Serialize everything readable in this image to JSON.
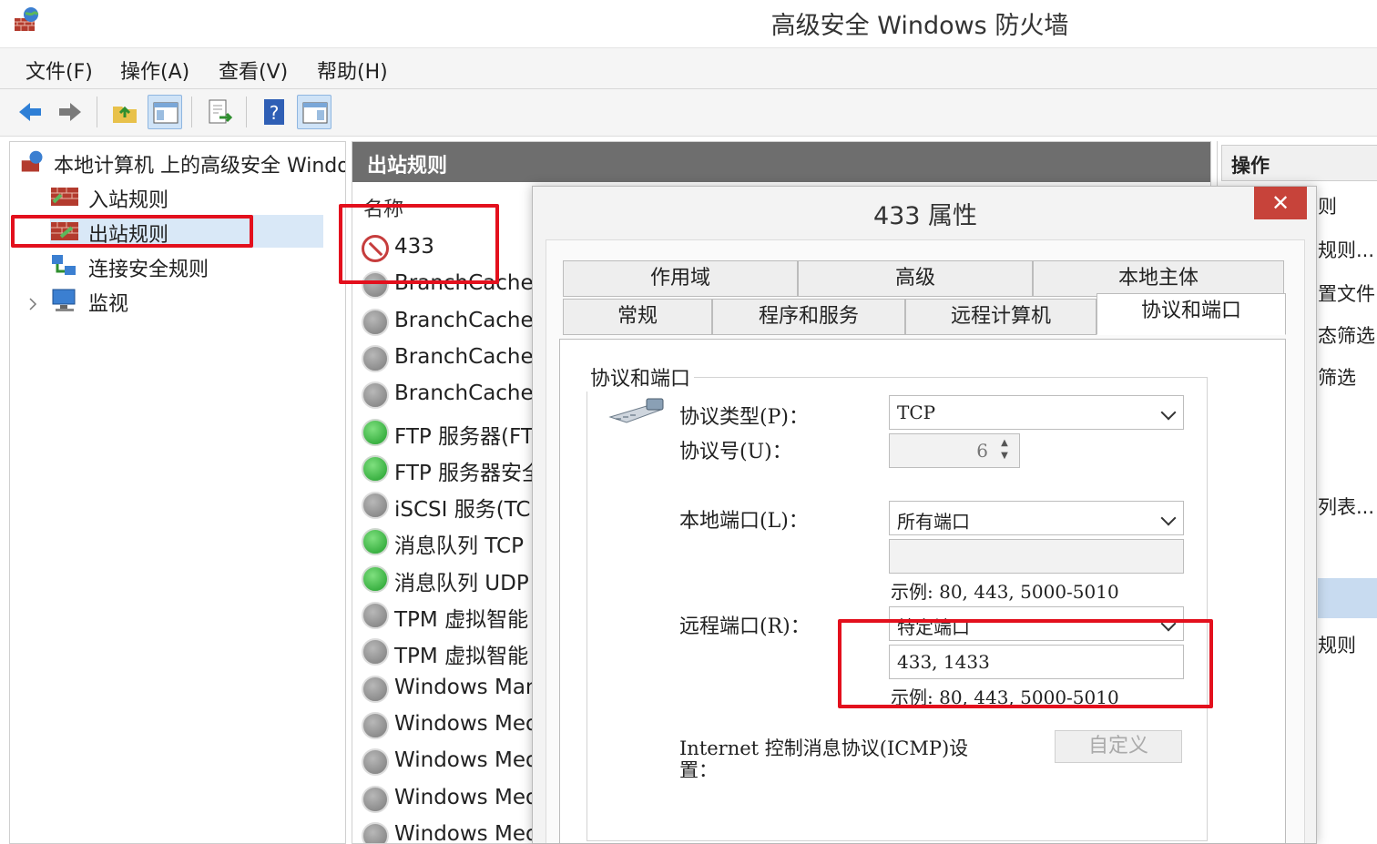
{
  "window": {
    "title": "高级安全 Windows 防火墙"
  },
  "menu": [
    "文件(F)",
    "操作(A)",
    "查看(V)",
    "帮助(H)"
  ],
  "tree": {
    "root": "本地计算机 上的高级安全 Windows",
    "items": [
      "入站规则",
      "出站规则",
      "连接安全规则",
      "监视"
    ]
  },
  "list": {
    "header": "出站规则",
    "column_name": "名称",
    "rules": [
      {
        "name": "433",
        "status": "blocked"
      },
      {
        "name": "BranchCache",
        "status": "disabled"
      },
      {
        "name": "BranchCache",
        "status": "disabled"
      },
      {
        "name": "BranchCache",
        "status": "disabled"
      },
      {
        "name": "BranchCache",
        "status": "disabled"
      },
      {
        "name": "FTP 服务器(FTP",
        "status": "enabled"
      },
      {
        "name": "FTP 服务器安全",
        "status": "enabled"
      },
      {
        "name": "iSCSI 服务(TCP",
        "status": "disabled"
      },
      {
        "name": "消息队列 TCP",
        "status": "enabled"
      },
      {
        "name": "消息队列 UDP",
        "status": "enabled"
      },
      {
        "name": "TPM 虚拟智能",
        "status": "disabled"
      },
      {
        "name": "TPM 虚拟智能",
        "status": "disabled"
      },
      {
        "name": "Windows Man",
        "status": "disabled"
      },
      {
        "name": "Windows Med",
        "status": "disabled"
      },
      {
        "name": "Windows Med",
        "status": "disabled"
      },
      {
        "name": "Windows Med",
        "status": "disabled"
      },
      {
        "name": "Windows Med",
        "status": "disabled"
      }
    ]
  },
  "actions": {
    "header": "操作",
    "items": [
      "则",
      "规则...",
      "置文件",
      "态筛选",
      "筛选",
      "列表...",
      "规则"
    ]
  },
  "dialog": {
    "title": "433 属性",
    "close": "✕",
    "tabs_top": [
      "作用域",
      "高级",
      "本地主体"
    ],
    "tabs_bottom": [
      "常规",
      "程序和服务",
      "远程计算机",
      "协议和端口"
    ],
    "group_title": "协议和端口",
    "protocol_type_label": "协议类型(P)：",
    "protocol_type_value": "TCP",
    "protocol_number_label": "协议号(U)：",
    "protocol_number_value": "6",
    "local_port_label": "本地端口(L)：",
    "local_port_value": "所有端口",
    "local_port_example": "示例: 80, 443, 5000-5010",
    "remote_port_label": "远程端口(R)：",
    "remote_port_value": "特定端口",
    "remote_port_entry": "433, 1433",
    "remote_port_example": "示例: 80, 443, 5000-5010",
    "icmp_label_line1": "Internet 控制消息协议(ICMP)设",
    "icmp_label_line2": "置：",
    "customize_button": "自定义"
  },
  "colors": {
    "highlight_red": "#e3101d",
    "header_gray": "#6e6e6e",
    "close_red": "#c7433a"
  }
}
